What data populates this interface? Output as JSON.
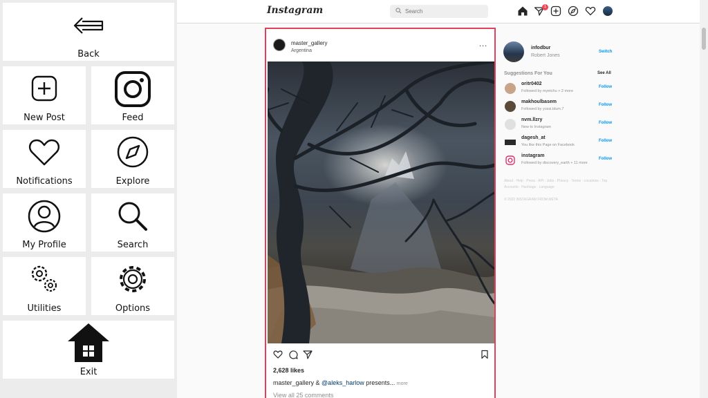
{
  "panel": {
    "back_label": "Back",
    "new_post_label": "New Post",
    "feed_label": "Feed",
    "notifications_label": "Notifications",
    "explore_label": "Explore",
    "my_profile_label": "My Profile",
    "search_label": "Search",
    "utilities_label": "Utilities",
    "options_label": "Options",
    "exit_label": "Exit"
  },
  "topbar": {
    "logo": "Instagram",
    "search_placeholder": "Search",
    "notification_count": "1"
  },
  "post": {
    "username": "master_gallery",
    "location": "Argentina",
    "more": "...",
    "likes": "2,628 likes",
    "caption_user": "master_gallery",
    "caption_amp": " & ",
    "caption_mention": "@aleks_harlow",
    "caption_text": " presents...",
    "caption_more": "more",
    "comments": "View all 25 comments"
  },
  "sidebar": {
    "username": "infodbur",
    "full_name": "Robert Jones",
    "switch_label": "Switch",
    "suggestions_title": "Suggestions For You",
    "see_all": "See All",
    "suggestions": [
      {
        "username": "oritr0402",
        "subtitle": "Followed by myetchu + 2 more",
        "follow": "Follow"
      },
      {
        "username": "makhoulbasem",
        "subtitle": "Followed by yossi.blum.7",
        "follow": "Follow"
      },
      {
        "username": "nvm.llzry",
        "subtitle": "New to Instagram",
        "follow": "Follow"
      },
      {
        "username": "dagesh_at",
        "subtitle": "You like this Page on Facebook",
        "follow": "Follow"
      },
      {
        "username": "instagram",
        "subtitle": "Followed by discovery_earth + 11 more",
        "follow": "Follow"
      }
    ],
    "footer_links": "About · Help · Press · API · Jobs · Privacy · Terms · Locations · Top Accounts · Hashtags · Language",
    "copyright": "© 2022 INSTAGRAM FROM META"
  },
  "colors": {
    "accent": "#0095f6",
    "highlight_border": "#e0405a",
    "badge": "#ed4956"
  }
}
